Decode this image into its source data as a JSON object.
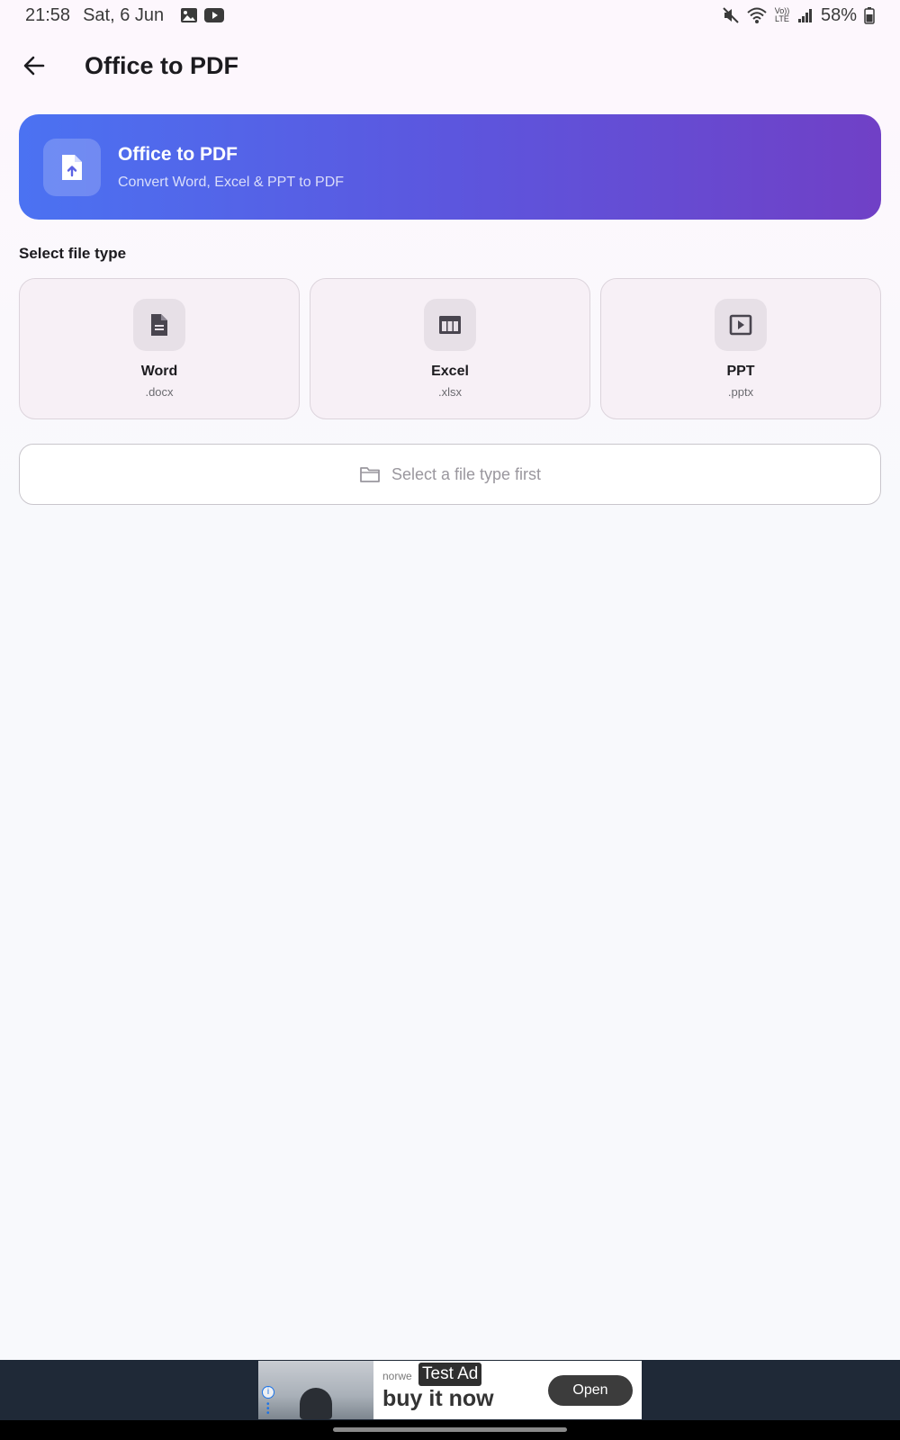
{
  "status_bar": {
    "time": "21:58",
    "date": "Sat, 6 Jun",
    "notification_icons": [
      "image-icon",
      "youtube-icon"
    ],
    "system_icons": [
      "mute-icon",
      "wifi-icon",
      "volte-icon",
      "signal-icon",
      "battery-icon"
    ],
    "volte_label": "Vo)) LTE",
    "battery": "58%"
  },
  "app_bar": {
    "back_icon": "back-arrow-icon",
    "title": "Office to PDF"
  },
  "banner": {
    "icon": "file-upload-icon",
    "title": "Office to PDF",
    "subtitle": "Convert Word, Excel & PPT to PDF",
    "gradient_start": "#4b72f2",
    "gradient_end": "#7040c6"
  },
  "section_label": "Select file type",
  "file_types": [
    {
      "name": "Word",
      "ext": ".docx",
      "icon": "document-icon"
    },
    {
      "name": "Excel",
      "ext": ".xlsx",
      "icon": "table-icon"
    },
    {
      "name": "PPT",
      "ext": ".pptx",
      "icon": "slideshow-icon"
    }
  ],
  "select_button": {
    "icon": "folder-icon",
    "label": "Select a file type first"
  },
  "ad": {
    "label": "Test Ad",
    "advertiser": "norwe",
    "headline": "buy it now",
    "cta": "Open"
  }
}
